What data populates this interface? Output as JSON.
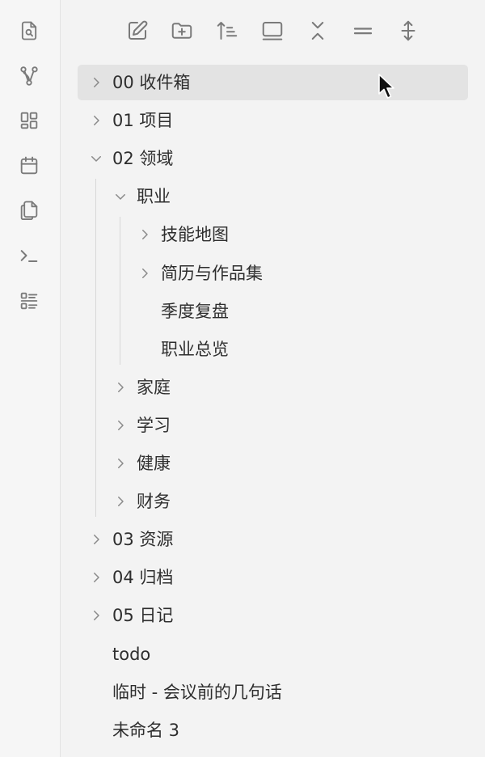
{
  "ribbon": {
    "items": [
      {
        "icon": "file-search-icon"
      },
      {
        "icon": "graph-icon"
      },
      {
        "icon": "grid-icon"
      },
      {
        "icon": "calendar-icon"
      },
      {
        "icon": "copy-icon"
      },
      {
        "icon": "terminal-icon"
      },
      {
        "icon": "list-icon"
      }
    ]
  },
  "toolbar": {
    "buttons": [
      {
        "icon": "new-note-icon"
      },
      {
        "icon": "new-folder-icon"
      },
      {
        "icon": "sort-icon"
      },
      {
        "icon": "auto-reveal-icon"
      },
      {
        "icon": "collapse-all-icon"
      },
      {
        "icon": "equal-icon"
      },
      {
        "icon": "expand-vertical-icon"
      }
    ]
  },
  "tree": {
    "items": [
      {
        "label": "00 收件箱",
        "type": "folder",
        "expanded": false,
        "active": true
      },
      {
        "label": "01 项目",
        "type": "folder",
        "expanded": false
      },
      {
        "label": "02 领域",
        "type": "folder",
        "expanded": true
      },
      {
        "label": "职业",
        "type": "folder",
        "expanded": true
      },
      {
        "label": "技能地图",
        "type": "folder",
        "expanded": false
      },
      {
        "label": "简历与作品集",
        "type": "folder",
        "expanded": false
      },
      {
        "label": "季度复盘",
        "type": "file"
      },
      {
        "label": "职业总览",
        "type": "file"
      },
      {
        "label": "家庭",
        "type": "folder",
        "expanded": false
      },
      {
        "label": "学习",
        "type": "folder",
        "expanded": false
      },
      {
        "label": "健康",
        "type": "folder",
        "expanded": false
      },
      {
        "label": "财务",
        "type": "folder",
        "expanded": false
      },
      {
        "label": "03 资源",
        "type": "folder",
        "expanded": false
      },
      {
        "label": "04 归档",
        "type": "folder",
        "expanded": false
      },
      {
        "label": "05 日记",
        "type": "folder",
        "expanded": false
      },
      {
        "label": "todo",
        "type": "file"
      },
      {
        "label": "临时 - 会议前的几句话",
        "type": "file"
      },
      {
        "label": "未命名 3",
        "type": "file"
      }
    ]
  },
  "colors": {
    "background": "#f3f3f3",
    "active_row": "#e3e3e3",
    "icon": "#7a7a7a",
    "text": "#2e2e2e"
  }
}
